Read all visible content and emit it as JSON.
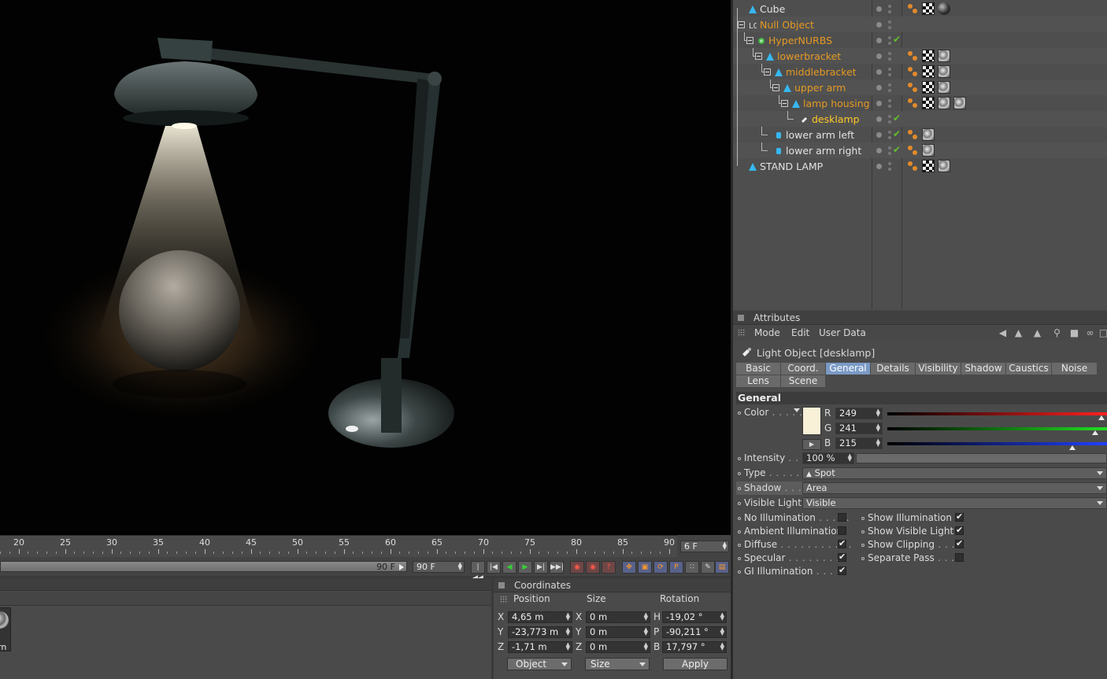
{
  "object_manager": {
    "rows": [
      {
        "name": "Cube",
        "color": "white",
        "indent": 0,
        "icon": "polygon-object-icon",
        "check": false,
        "tags": [
          "phong",
          "checker",
          "sphere"
        ]
      },
      {
        "name": "Null Object",
        "color": "orange",
        "indent": 0,
        "icon": "null-object-icon",
        "check": false,
        "tags": []
      },
      {
        "name": "HyperNURBS",
        "color": "orange",
        "indent": 1,
        "icon": "hypernurbs-icon",
        "check": true,
        "tags": []
      },
      {
        "name": "lowerbracket",
        "color": "orange",
        "indent": 2,
        "icon": "polygon-object-icon",
        "check": false,
        "tags": [
          "phong",
          "checker",
          "metal"
        ]
      },
      {
        "name": "middlebracket",
        "color": "orange",
        "indent": 3,
        "icon": "polygon-object-icon",
        "check": false,
        "tags": [
          "phong",
          "checker",
          "metal"
        ]
      },
      {
        "name": "upper arm",
        "color": "orange",
        "indent": 4,
        "icon": "polygon-object-icon",
        "check": false,
        "tags": [
          "phong",
          "checker",
          "metal"
        ]
      },
      {
        "name": "lamp housing",
        "color": "orange",
        "indent": 5,
        "icon": "polygon-object-icon",
        "check": false,
        "tags": [
          "phong",
          "checker",
          "metal",
          "metal"
        ]
      },
      {
        "name": "desklamp",
        "color": "yellow",
        "indent": 6,
        "icon": "light-object-icon",
        "check": true,
        "tags": []
      },
      {
        "name": "lower arm left",
        "color": "white",
        "indent": 3,
        "icon": "cylinder-object-icon",
        "check": true,
        "tags": [
          "phong",
          "metal"
        ]
      },
      {
        "name": "lower arm right",
        "color": "white",
        "indent": 3,
        "icon": "cylinder-object-icon",
        "check": true,
        "tags": [
          "phong",
          "metal"
        ]
      },
      {
        "name": "STAND LAMP",
        "color": "white",
        "indent": 0,
        "icon": "polygon-object-icon",
        "check": false,
        "tags": [
          "phong",
          "checker",
          "metal"
        ]
      }
    ]
  },
  "attributes": {
    "title": "Attributes",
    "menu": [
      "Mode",
      "Edit",
      "User Data"
    ],
    "object_title": "Light Object [desklamp]",
    "tabs_row1": [
      "Basic",
      "Coord.",
      "General",
      "Details",
      "Visibility",
      "Shadow",
      "Caustics",
      "Noise"
    ],
    "tabs_row2": [
      "Lens",
      "Scene"
    ],
    "active_tab": "General",
    "section": "General",
    "color_label": "Color",
    "color_hex": "#f9f1d7",
    "r_label": "R",
    "r_value": "249",
    "r_fraction": 0.976,
    "g_label": "G",
    "g_value": "241",
    "g_fraction": 0.945,
    "b_label": "B",
    "b_value": "215",
    "b_fraction": 0.843,
    "intensity_label": "Intensity",
    "intensity_value": "100 %",
    "type_label": "Type",
    "type_value": "Spot",
    "shadow_label": "Shadow",
    "shadow_value": "Area",
    "visible_label": "Visible Light",
    "visible_value": "Visible",
    "checkboxes_left": [
      {
        "label": "No Illumination",
        "on": false
      },
      {
        "label": "Ambient Illumination",
        "on": false
      },
      {
        "label": "Diffuse",
        "on": true
      },
      {
        "label": "Specular",
        "on": true
      },
      {
        "label": "GI Illumination",
        "on": true
      }
    ],
    "checkboxes_right": [
      {
        "label": "Show Illumination",
        "on": true
      },
      {
        "label": "Show Visible Light",
        "on": true
      },
      {
        "label": "Show Clipping",
        "on": true
      },
      {
        "label": "Separate Pass",
        "on": false
      }
    ]
  },
  "timeline": {
    "ticks": [
      "20",
      "25",
      "30",
      "35",
      "40",
      "45",
      "50",
      "55",
      "60",
      "65",
      "70",
      "75",
      "80",
      "85",
      "90"
    ],
    "current_frame": "6 F",
    "scrub_label": "90 F",
    "end_frame": "90 F"
  },
  "material": {
    "label": "rn"
  },
  "coordinates": {
    "title": "Coordinates",
    "position_head": "Position",
    "size_head": "Size",
    "rotation_head": "Rotation",
    "pos": [
      {
        "axis": "X",
        "value": "4,65 m"
      },
      {
        "axis": "Y",
        "value": "-23,773 m"
      },
      {
        "axis": "Z",
        "value": "-1,71 m"
      }
    ],
    "size": [
      {
        "axis": "X",
        "value": "0 m"
      },
      {
        "axis": "Y",
        "value": "0 m"
      },
      {
        "axis": "Z",
        "value": "0 m"
      }
    ],
    "rot": [
      {
        "axis": "H",
        "value": "-19,02 °"
      },
      {
        "axis": "P",
        "value": "-90,211 °"
      },
      {
        "axis": "B",
        "value": "17,797 °"
      }
    ],
    "mode_dropdown": "Object",
    "size_dropdown": "Size",
    "apply_label": "Apply"
  }
}
